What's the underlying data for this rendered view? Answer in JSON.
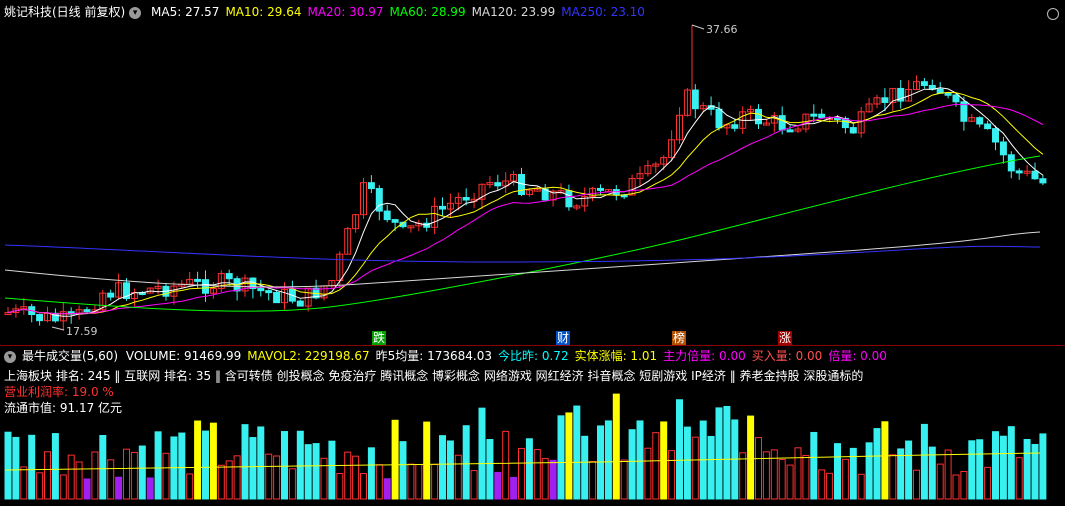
{
  "main": {
    "title": "姚记科技(日线 前复权)",
    "indicators": [
      {
        "label": "MA5: 27.57",
        "color": "#ffffff"
      },
      {
        "label": "MA10: 29.64",
        "color": "#ffff00"
      },
      {
        "label": "MA20: 30.97",
        "color": "#ff00ff"
      },
      {
        "label": "MA60: 28.99",
        "color": "#00ff00"
      },
      {
        "label": "MA120: 23.99",
        "color": "#d8d8d8"
      },
      {
        "label": "MA250: 23.10",
        "color": "#3333ff"
      }
    ],
    "max_price": "37.66",
    "min_price": "17.59",
    "markers": [
      {
        "text": "跌",
        "bg": "#00a000"
      },
      {
        "text": "财",
        "bg": "#0050c8"
      },
      {
        "text": "榜",
        "bg": "#b05000"
      },
      {
        "text": "涨",
        "bg": "#a00000"
      }
    ]
  },
  "volume": {
    "title": "最牛成交量(5,60)",
    "items": [
      {
        "label": "VOLUME: 91469.99",
        "color": "#ffffff"
      },
      {
        "label": "MAVOL2: 229198.67",
        "color": "#ffff00"
      },
      {
        "label": "昨5均量: 173684.03",
        "color": "#ffffff"
      },
      {
        "label": "今比昨: 0.72",
        "color": "#00ffff"
      },
      {
        "label": "实体涨幅: 1.01",
        "color": "#ffff00"
      },
      {
        "label": "主力倍量: 0.00",
        "color": "#ff00ff"
      },
      {
        "label": "买入量: 0.00",
        "color": "#ff5050"
      },
      {
        "label": "倍量: 0.00",
        "color": "#ff00ff"
      }
    ],
    "info_line1": "上海板块  排名: 245  ‖  互联网  排名: 35  ‖  含可转债 创投概念 免疫治疗 腾讯概念 博彩概念 网络游戏 网红经济 抖音概念 短剧游戏 IP经济  ‖  养老金持股 深股通标的",
    "info_line2": "营业利润率: 19.0 %",
    "info_line3": "流通市值:  91.17 亿元"
  }
}
